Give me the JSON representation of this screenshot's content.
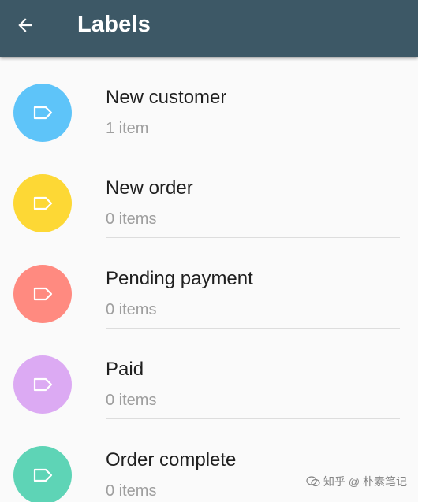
{
  "header": {
    "title": "Labels",
    "background": "#3d5866"
  },
  "labels": [
    {
      "name": "New customer",
      "count": "1 item",
      "color": "#5ec4f9"
    },
    {
      "name": "New order",
      "count": "0 items",
      "color": "#fdd835"
    },
    {
      "name": "Pending payment",
      "count": "0 items",
      "color": "#ff8a80"
    },
    {
      "name": "Paid",
      "count": "0 items",
      "color": "#dcaaf3"
    },
    {
      "name": "Order complete",
      "count": "0 items",
      "color": "#5ed4b6"
    }
  ],
  "icons": {
    "back": "arrow-left-icon",
    "label": "label-tag-icon",
    "watermark": "wechat-icon"
  },
  "watermark": {
    "text": "知乎 @ 朴素笔记"
  }
}
